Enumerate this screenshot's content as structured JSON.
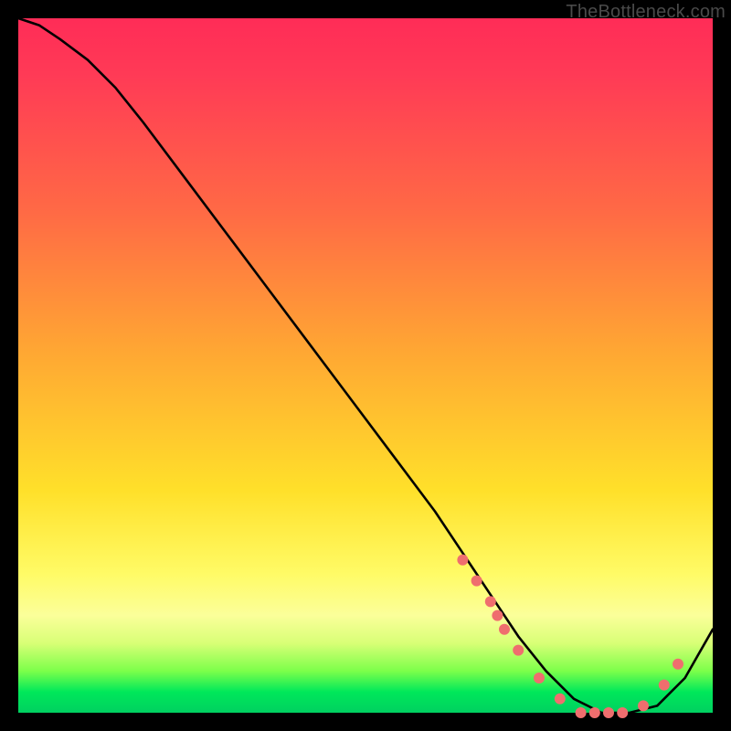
{
  "watermark": "TheBottleneck.com",
  "chart_data": {
    "type": "line",
    "title": "",
    "xlabel": "",
    "ylabel": "",
    "xlim": [
      0,
      100
    ],
    "ylim": [
      0,
      100
    ],
    "grid": false,
    "legend": false,
    "series": [
      {
        "name": "bottleneck-curve",
        "color": "#000000",
        "x": [
          0,
          3,
          6,
          10,
          14,
          18,
          24,
          30,
          36,
          42,
          48,
          54,
          60,
          64,
          68,
          72,
          76,
          80,
          84,
          88,
          92,
          96,
          100
        ],
        "y": [
          100,
          99,
          97,
          94,
          90,
          85,
          77,
          69,
          61,
          53,
          45,
          37,
          29,
          23,
          17,
          11,
          6,
          2,
          0,
          0,
          1,
          5,
          12
        ]
      }
    ],
    "markers": {
      "name": "highlight-dots",
      "color": "#ef6e6e",
      "radius_px": 6,
      "x": [
        64,
        66,
        68,
        69,
        70,
        72,
        75,
        78,
        81,
        83,
        85,
        87,
        90,
        93,
        95
      ],
      "y": [
        22,
        19,
        16,
        14,
        12,
        9,
        5,
        2,
        0,
        0,
        0,
        0,
        1,
        4,
        7
      ]
    },
    "background_gradient": {
      "direction": "vertical",
      "stops": [
        {
          "pos": 0.0,
          "color": "#ff2c57"
        },
        {
          "pos": 0.28,
          "color": "#ff6a45"
        },
        {
          "pos": 0.48,
          "color": "#ffa733"
        },
        {
          "pos": 0.68,
          "color": "#ffe02a"
        },
        {
          "pos": 0.86,
          "color": "#fbff9a"
        },
        {
          "pos": 0.97,
          "color": "#00e85a"
        }
      ]
    }
  }
}
